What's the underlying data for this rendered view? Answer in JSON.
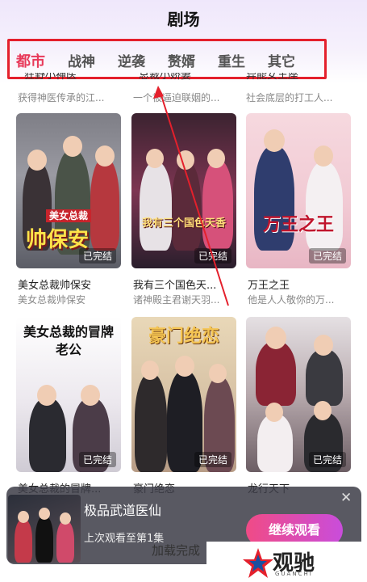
{
  "header": {
    "title": "剧场"
  },
  "tabs": [
    {
      "label": "都市",
      "active": true
    },
    {
      "label": "战神",
      "active": false
    },
    {
      "label": "逆袭",
      "active": false
    },
    {
      "label": "赘婿",
      "active": false
    },
    {
      "label": "重生",
      "active": false
    },
    {
      "label": "其它",
      "active": false
    }
  ],
  "peek_row": [
    {
      "title": "狂野小神医",
      "subtitle": "获得神医传承的江..."
    },
    {
      "title": "总裁小娇妻",
      "subtitle": "一个被逼迫联姻的..."
    },
    {
      "title": "异能女王座",
      "subtitle": "社会底层的打工人..."
    }
  ],
  "dramas": [
    {
      "title": "美女总裁帅保安",
      "subtitle": "美女总裁帅保安",
      "status": "已完结",
      "poster_text": "帅保安",
      "poster_tag": "美女总裁"
    },
    {
      "title": "我有三个国色天...",
      "subtitle": "诸神殿主君谢天羽...",
      "status": "已完结",
      "poster_text": "我有三个国色天香"
    },
    {
      "title": "万王之王",
      "subtitle": "他是人人敬你的万...",
      "status": "已完结",
      "poster_text": "万王之王"
    },
    {
      "title": "美女总裁的冒牌...",
      "subtitle": "",
      "status": "已完结",
      "poster_text": "美女总裁的冒牌老公"
    },
    {
      "title": "豪门绝恋",
      "subtitle": "",
      "status": "已完结",
      "poster_text": "豪门绝恋"
    },
    {
      "title": "龙行天下",
      "subtitle": "",
      "status": "已完结",
      "poster_text": ""
    }
  ],
  "continue_bar": {
    "title": "极品武道医仙",
    "progress": "上次观看至第1集",
    "button": "继续观看"
  },
  "footer": {
    "loading": "加载完成"
  },
  "watermark": {
    "text": "观驰",
    "sub": "GUANCHI"
  },
  "colors": {
    "active_tab": "#e83a5a",
    "annotation": "#e4202c",
    "button_start": "#f04b86",
    "button_end": "#c94ddb"
  },
  "icons": [
    "close-icon",
    "arrow-annotation"
  ]
}
